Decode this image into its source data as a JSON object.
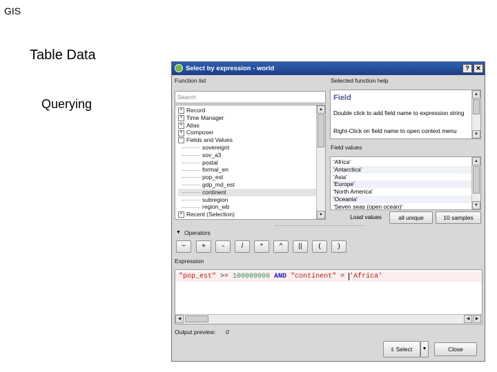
{
  "slide": {
    "header": "GIS",
    "title": "Table Data",
    "subtitle": "Querying"
  },
  "dialog": {
    "title": "Select by expression - world",
    "help_button": "?",
    "close_button": "✕",
    "function_list_label": "Function list",
    "search_placeholder": "Search",
    "tree": [
      {
        "label": "Record",
        "expander": "+",
        "level": 0
      },
      {
        "label": "Time Manager",
        "expander": "+",
        "level": 0
      },
      {
        "label": "Atlas",
        "expander": "+",
        "level": 0
      },
      {
        "label": "Composer",
        "expander": "+",
        "level": 0
      },
      {
        "label": "Fields and Values",
        "expander": "−",
        "level": 0
      },
      {
        "label": "sovereignt",
        "level": 1
      },
      {
        "label": "sov_a3",
        "level": 1
      },
      {
        "label": "postal",
        "level": 1
      },
      {
        "label": "formal_en",
        "level": 1
      },
      {
        "label": "pop_est",
        "level": 1
      },
      {
        "label": "gdp_md_est",
        "level": 1
      },
      {
        "label": "continent",
        "level": 1,
        "selected": true
      },
      {
        "label": "subregion",
        "level": 1
      },
      {
        "label": "region_wb",
        "level": 1
      },
      {
        "label": "Recent (Selection)",
        "expander": "+",
        "level": 0
      }
    ],
    "help_label": "Selected function help",
    "help_heading": "Field",
    "help_text_1": "Double click to add field name to expression string",
    "help_text_2": "Right-Click on field name to open context menu",
    "field_values_label": "Field values",
    "field_values": [
      "'Africa'",
      "'Antarctica'",
      "'Asia'",
      "'Europe'",
      "'North America'",
      "'Oceania'",
      "'Seven seas (open ocean)'"
    ],
    "load_values_label": "Load values",
    "all_unique_label": "all unique",
    "samples_label": "10 samples",
    "operators_label": "Operators",
    "operators": [
      "−",
      "+",
      "-",
      "/",
      "*",
      "^",
      "||",
      "(",
      ")"
    ],
    "expression_label": "Expression",
    "expression": {
      "field1": "\"pop_est\"",
      "op1": " >= ",
      "number": "100000000",
      "and": " AND ",
      "field2": "\"continent\"",
      "op2": " = ",
      "string": "'Africa'"
    },
    "output_preview_label": "Output preview:",
    "output_preview_value": "0",
    "select_label": "Select",
    "close_label": "Close"
  },
  "colors": {
    "titlebar": "#2448a0",
    "field_token": "#b31b1b",
    "number_token": "#2e8b57",
    "keyword_token": "#1a1aa6",
    "string_token": "#b31b1b"
  }
}
